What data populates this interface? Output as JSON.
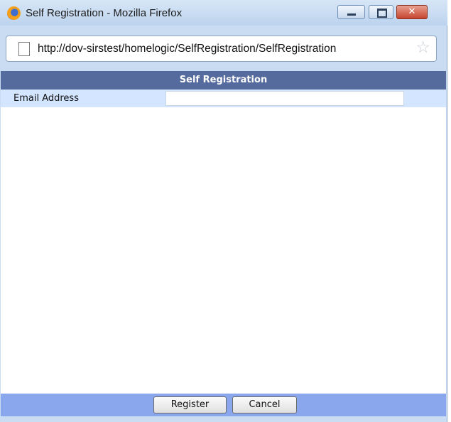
{
  "window": {
    "title": "Self Registration - Mozilla Firefox",
    "close_glyph": "✕",
    "url": "http://dov-sirstest/homelogic/SelfRegistration/SelfRegistration",
    "icons": [
      "firefox-icon",
      "minimize-icon",
      "maximize-icon",
      "close-icon",
      "page-icon",
      "bookmark-star-icon"
    ]
  },
  "form": {
    "header": "Self Registration",
    "email_label": "Email Address",
    "email_value": ""
  },
  "footer": {
    "register_label": "Register",
    "cancel_label": "Cancel"
  },
  "colors": {
    "header_bg": "#556b9d",
    "row_bg": "#d3e5ff",
    "footer_bg": "#8aa6ec"
  }
}
